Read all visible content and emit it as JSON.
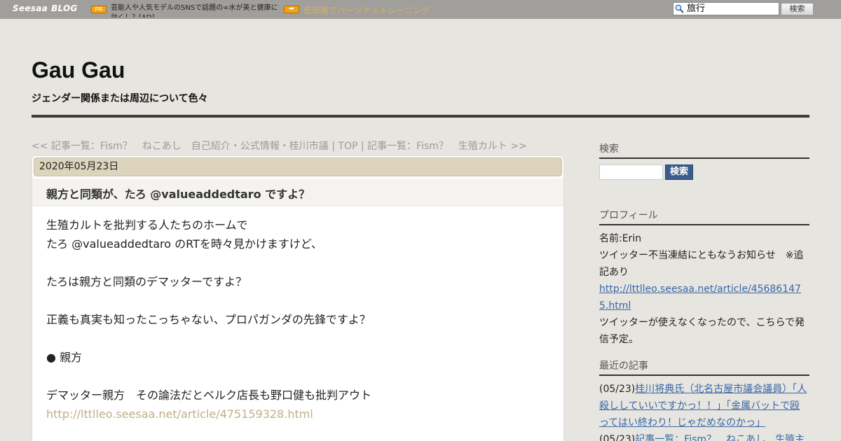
{
  "topbar": {
    "logo": "Seesaa",
    "logo_blog": "BLOG",
    "pr_badge": "PR",
    "ad1_text": "芸能人や人気モデルのSNSで話題の∞水が美と健康に効く！？[AD]",
    "ad2_arrow": "➡",
    "ad2_text": "低価格でパーソナルトレーニング",
    "search_value": "旅行",
    "search_button": "検索",
    "search_icon": "magnifier-icon"
  },
  "header": {
    "title": "Gau Gau",
    "description": "ジェンダー関係または周辺について色々"
  },
  "nav": {
    "prev": "<< 記事一覧：Fism？　ねこあし　自己紹介・公式情報・桂川市議",
    "sep1": " | ",
    "top": "TOP",
    "sep2": " | ",
    "next": "記事一覧：Fism？　生殖カルト >>"
  },
  "article": {
    "date": "2020年05月23日",
    "title": "親方と同類が、たろ @valueaddedtaro ですよ？",
    "lines": [
      "生殖カルトを批判する人たちのホームで",
      "たろ @valueaddedtaro のRTを時々見かけますけど、",
      "",
      "たろは親方と同類のデマッターですよ？",
      "",
      "正義も真実も知ったこっちゃない、プロパガンダの先鋒ですよ？",
      "",
      "● 親方",
      "",
      "デマッター親方　その論法だとベルク店長も野口健も批判アウト"
    ],
    "link": "http://lttlleo.seesaa.net/article/475159328.html"
  },
  "sidebar": {
    "search_heading": "検索",
    "search_button": "検索",
    "profile_heading": "プロフィール",
    "profile_name": "名前:Erin",
    "profile_notice": "ツイッター不当凍結にともなうお知らせ　※追記あり",
    "profile_link": "http://lttlleo.seesaa.net/article/456861475.html",
    "profile_note": "ツイッターが使えなくなったので、こちらで発信予定。",
    "recent_heading": "最近の記事",
    "recent": [
      {
        "date": "(05/23)",
        "title": "桂川将典氏（北名古屋市議会議員）「人殺ししていいですかっ！！」「金属バットで殴ってはい終わり！じゃだめなのかっ」"
      },
      {
        "date": "(05/23)",
        "title": "記事一覧：Fism？　ねこあし　生殖主"
      }
    ]
  }
}
